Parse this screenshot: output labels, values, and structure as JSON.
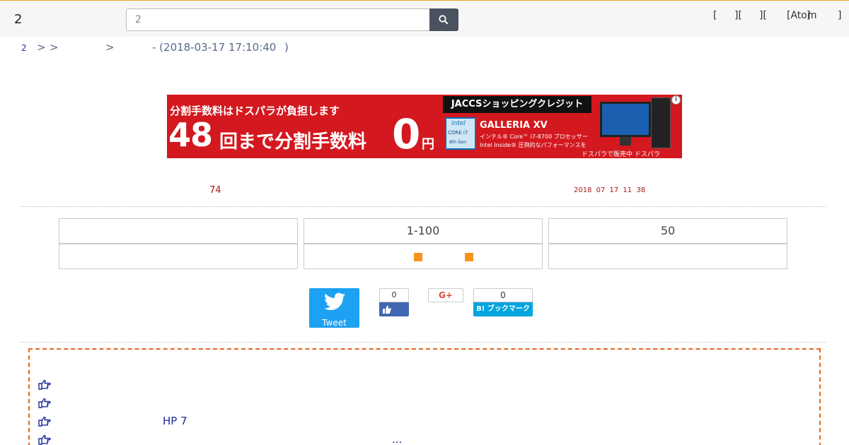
{
  "header": {
    "site_title": "2",
    "search_value": "2",
    "links": [
      "[",
      "][",
      "][",
      "[Atom",
      "]",
      "]"
    ]
  },
  "breadcrumb": {
    "home": "2",
    "sep1": ">",
    "sep2": ">",
    "sep3": ">",
    "timestamp": "- (2018-03-17 17:10:40",
    "close": ")"
  },
  "ad": {
    "line1": "分割手数料はドスパラが負担します",
    "big_number": "48",
    "main_text": "回まで分割手数料",
    "zero": "0",
    "yen": "円",
    "jaccs": "JACCSショッピングクレジット",
    "intel_brand": "intel",
    "intel_model": "CORE i7",
    "intel_gen": "8th Gen",
    "product": "GALLERIA XV",
    "cpu": "インテル® Core™ i7-8700 プロセッサー",
    "inside": "Intel Inside® 圧倒的なパフォーマンスを",
    "dospara": "ドスパラで販売中 ドスパラ",
    "info": "i"
  },
  "stats": {
    "count": "74",
    "date": "2018 07 17 11 38"
  },
  "nav": {
    "row1": [
      "",
      "1-100",
      "50"
    ],
    "row2": [
      "",
      "",
      ""
    ]
  },
  "social": {
    "tweet_label": "Tweet",
    "fb_count": "0",
    "gplus_label": "G+",
    "hatena_count": "0",
    "hatena_label": "B! ブックマーク"
  },
  "related": {
    "items": [
      {
        "text": ""
      },
      {
        "text": ""
      },
      {
        "text": "HP 7"
      },
      {
        "text": "..."
      }
    ]
  },
  "colors": {
    "accent_orange": "#f7931e",
    "dashed_border": "#e8671a",
    "link_blue": "#1a2a9a",
    "stat_red": "#aa1515",
    "ad_red": "#d3181f",
    "twitter": "#1da1f2",
    "facebook": "#4267b2",
    "hatena": "#00a4de"
  }
}
